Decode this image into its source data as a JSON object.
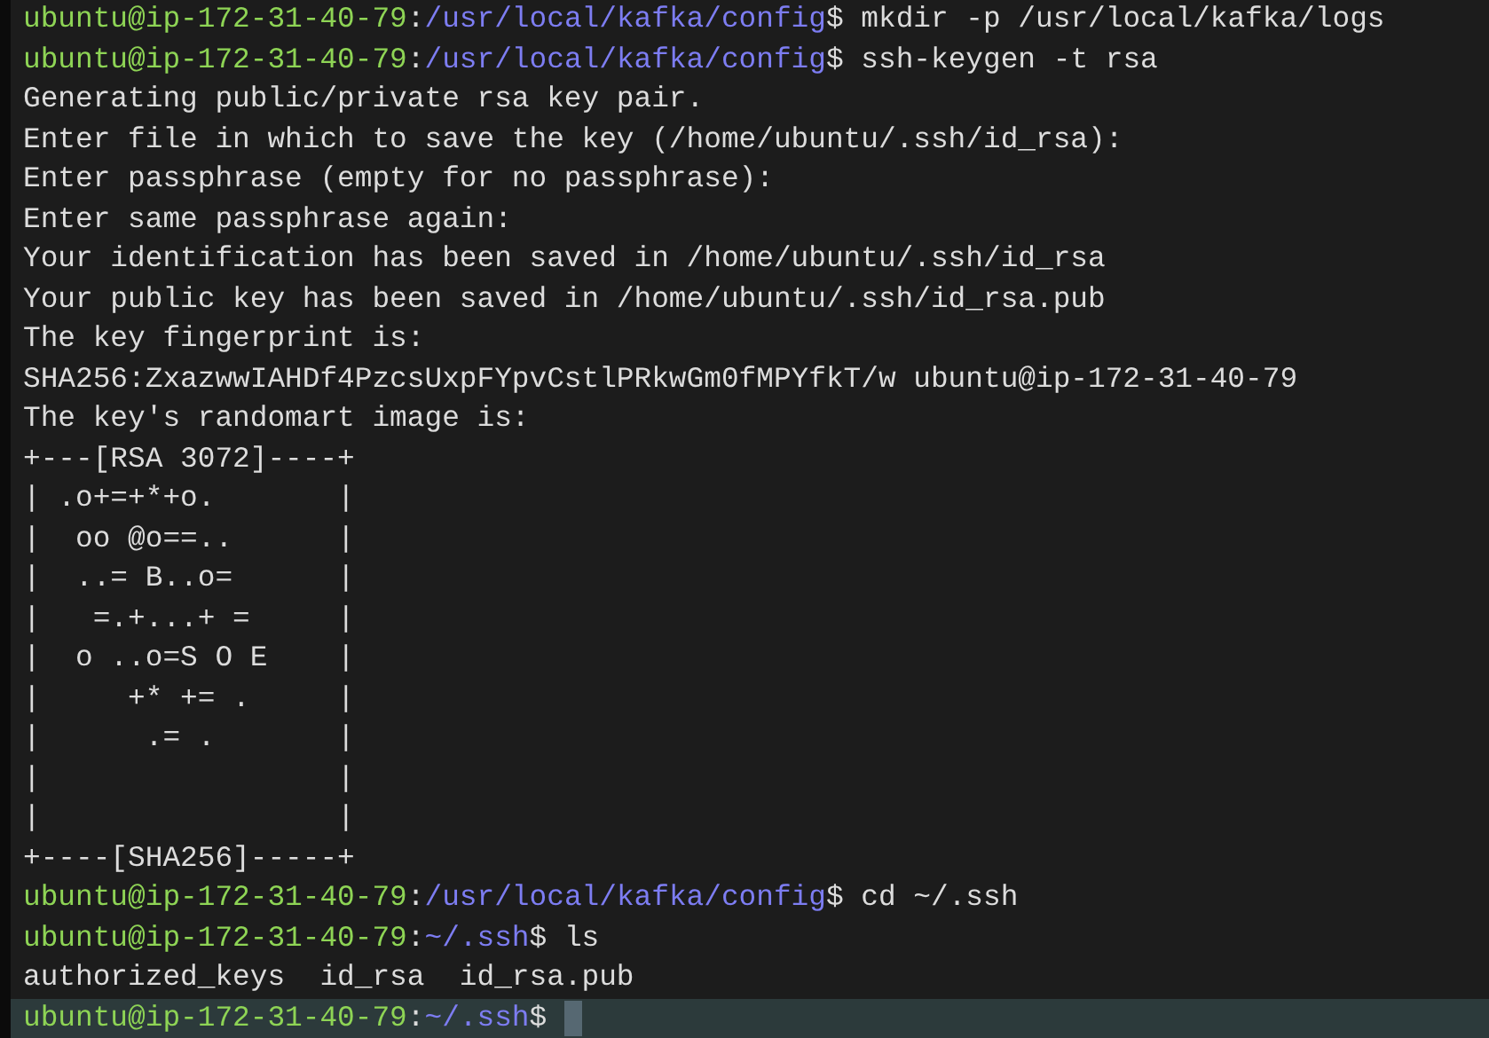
{
  "terminal": {
    "lines": [
      {
        "kind": "prompt",
        "user_host": "ubuntu@ip-172-31-40-79",
        "colon": ":",
        "path": "/usr/local/kafka/config",
        "dollar": "$",
        "command": "mkdir -p /usr/local/kafka/logs",
        "current": false
      },
      {
        "kind": "prompt",
        "user_host": "ubuntu@ip-172-31-40-79",
        "colon": ":",
        "path": "/usr/local/kafka/config",
        "dollar": "$",
        "command": "ssh-keygen -t rsa",
        "current": false
      },
      {
        "kind": "output",
        "text": "Generating public/private rsa key pair."
      },
      {
        "kind": "output",
        "text": "Enter file in which to save the key (/home/ubuntu/.ssh/id_rsa):"
      },
      {
        "kind": "output",
        "text": "Enter passphrase (empty for no passphrase):"
      },
      {
        "kind": "output",
        "text": "Enter same passphrase again:"
      },
      {
        "kind": "output",
        "text": "Your identification has been saved in /home/ubuntu/.ssh/id_rsa"
      },
      {
        "kind": "output",
        "text": "Your public key has been saved in /home/ubuntu/.ssh/id_rsa.pub"
      },
      {
        "kind": "output",
        "text": "The key fingerprint is:"
      },
      {
        "kind": "output",
        "text": "SHA256:ZxazwwIAHDf4PzcsUxpFYpvCstlPRkwGm0fMPYfkT/w ubuntu@ip-172-31-40-79"
      },
      {
        "kind": "output",
        "text": "The key's randomart image is:"
      },
      {
        "kind": "output",
        "text": "+---[RSA 3072]----+"
      },
      {
        "kind": "output",
        "text": "| .o+=+*+o.       |"
      },
      {
        "kind": "output",
        "text": "|  oo @o==..      |"
      },
      {
        "kind": "output",
        "text": "|  ..= B..o=      |"
      },
      {
        "kind": "output",
        "text": "|   =.+...+ =     |"
      },
      {
        "kind": "output",
        "text": "|  o ..o=S O E    |"
      },
      {
        "kind": "output",
        "text": "|     +* += .     |"
      },
      {
        "kind": "output",
        "text": "|      .= .       |"
      },
      {
        "kind": "output",
        "text": "|                 |"
      },
      {
        "kind": "output",
        "text": "|                 |"
      },
      {
        "kind": "output",
        "text": "+----[SHA256]-----+"
      },
      {
        "kind": "prompt",
        "user_host": "ubuntu@ip-172-31-40-79",
        "colon": ":",
        "path": "/usr/local/kafka/config",
        "dollar": "$",
        "command": "cd ~/.ssh",
        "current": false
      },
      {
        "kind": "prompt",
        "user_host": "ubuntu@ip-172-31-40-79",
        "colon": ":",
        "path": "~/.ssh",
        "dollar": "$",
        "command": "ls",
        "current": false
      },
      {
        "kind": "output",
        "text": "authorized_keys  id_rsa  id_rsa.pub"
      },
      {
        "kind": "prompt",
        "user_host": "ubuntu@ip-172-31-40-79",
        "colon": ":",
        "path": "~/.ssh",
        "dollar": "$",
        "current": true
      }
    ]
  }
}
